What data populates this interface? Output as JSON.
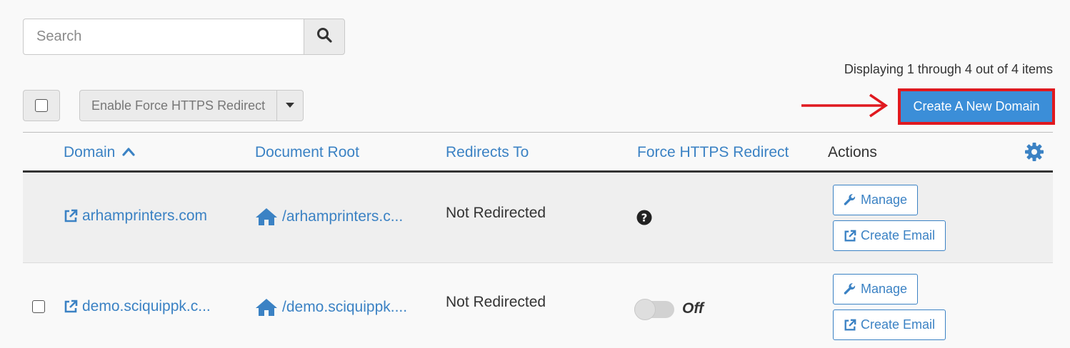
{
  "search": {
    "placeholder": "Search",
    "button_icon": "search-icon"
  },
  "pagination": {
    "displaying": "Displaying 1 through 4 out of 4 items"
  },
  "toolbar": {
    "bulk_action": "Enable Force HTTPS Redirect",
    "create_label": "Create A New Domain"
  },
  "annotation": {
    "arrow_color": "#e0191f",
    "highlight_color": "#e0191f"
  },
  "columns": {
    "domain": "Domain",
    "document_root": "Document Root",
    "redirects_to": "Redirects To",
    "force_https": "Force HTTPS Redirect",
    "actions": "Actions"
  },
  "rows": [
    {
      "domain": "arhamprinters.com",
      "document_root": "/arhamprinters.c...",
      "redirects_to": "Not Redirected",
      "force_https": "unknown",
      "manage": "Manage",
      "create_email": "Create Email"
    },
    {
      "domain": "demo.sciquippk.c...",
      "document_root": "/demo.sciquippk....",
      "redirects_to": "Not Redirected",
      "force_https": "Off",
      "manage": "Manage",
      "create_email": "Create Email"
    }
  ],
  "colors": {
    "link": "#3b82c4",
    "primary_button": "#3b8ed8"
  }
}
